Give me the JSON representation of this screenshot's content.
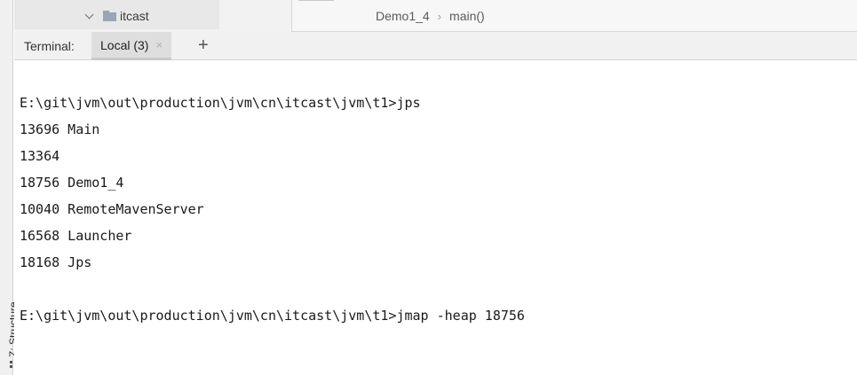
{
  "project_tree": {
    "folder_label": "itcast",
    "folder_icon": "folder-icon",
    "expand_icon": "chevron-down-icon"
  },
  "breadcrumb": {
    "file": "Demo1_4",
    "separator": "›",
    "method": "main()"
  },
  "terminal_panel": {
    "label": "Terminal:",
    "tab_label": "Local (3)",
    "tab_close": "×",
    "add_tab": "+"
  },
  "terminal_output": [
    "E:\\git\\jvm\\out\\production\\jvm\\cn\\itcast\\jvm\\t1>jps",
    "13696 Main",
    "13364",
    "18756 Demo1_4",
    "10040 RemoteMavenServer",
    "16568 Launcher",
    "18168 Jps",
    "",
    "E:\\git\\jvm\\out\\production\\jvm\\cn\\itcast\\jvm\\t1>jmap -heap 18756"
  ],
  "side_tools": {
    "structure_label": "Z: Structure",
    "structure_icon": "structure-icon"
  }
}
